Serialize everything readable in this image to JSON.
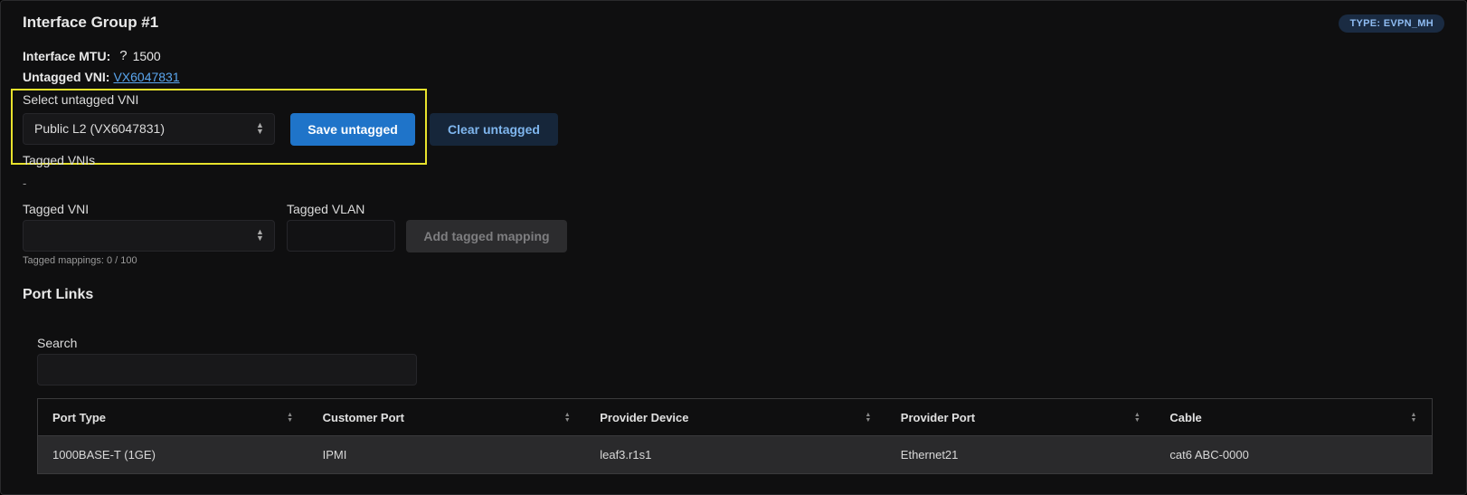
{
  "group": {
    "title": "Interface Group #1",
    "type_badge": "TYPE: EVPN_MH",
    "mtu_label": "Interface MTU:",
    "mtu_help": "?",
    "mtu_value": "1500",
    "untagged_label": "Untagged VNI:",
    "untagged_value": "VX6047831"
  },
  "untagged": {
    "select_label": "Select untagged VNI",
    "selected_value": "Public L2 (VX6047831)",
    "save_label": "Save untagged",
    "clear_label": "Clear untagged"
  },
  "tagged": {
    "title": "Tagged VNIs",
    "empty_value": "-",
    "vni_label": "Tagged VNI",
    "vni_value": "",
    "vlan_label": "Tagged VLAN",
    "add_label": "Add tagged mapping",
    "hint": "Tagged mappings: 0 / 100"
  },
  "port_links": {
    "title": "Port Links",
    "search_label": "Search",
    "search_value": "",
    "columns": [
      "Port Type",
      "Customer Port",
      "Provider Device",
      "Provider Port",
      "Cable"
    ],
    "rows": [
      [
        "1000BASE-T (1GE)",
        "IPMI",
        "leaf3.r1s1",
        "Ethernet21",
        "cat6 ABC-0000"
      ]
    ]
  },
  "icons": {
    "select_chevron": "chevron-up-down-icon",
    "sort": "sort-icon"
  },
  "colors": {
    "accent": "#1f74c9",
    "link": "#5aa6ee",
    "highlight": "#e8e22c",
    "badge_bg": "#1a2b42",
    "badge_text": "#8fbcf2"
  }
}
